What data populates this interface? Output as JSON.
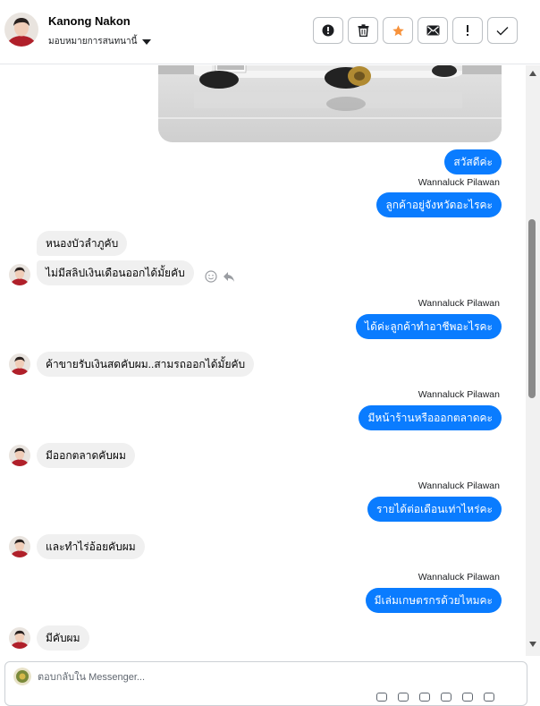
{
  "header": {
    "name": "Kanong Nakon",
    "assign_label": "มอบหมายการสนทนานี้",
    "actions": [
      {
        "name": "alert-circle-icon"
      },
      {
        "name": "trash-icon"
      },
      {
        "name": "star-icon",
        "color": "#f7923b"
      },
      {
        "name": "mail-icon"
      },
      {
        "name": "exclamation-icon"
      },
      {
        "name": "check-icon"
      }
    ]
  },
  "messages": {
    "out1": "สวัสดีค่ะ",
    "sender1": "Wannaluck Pilawan",
    "out2": "ลูกค้าอยู่จังหวัดอะไรคะ",
    "in1": "หนองบัวลำภูคับ",
    "in2": "ไม่มีสลิปเงินเดือนออกได้มั้ยคับ",
    "sender2": "Wannaluck Pilawan",
    "out3": "ได้ค่ะลูกค้าทำอาชีพอะไรคะ",
    "in3": "ค้าขายรับเงินสดคับผม..สามรถออกได้มั้ยคับ",
    "sender3": "Wannaluck Pilawan",
    "out4": "มีหน้าร้านหรือออกตลาดคะ",
    "in4": "มีออกตลาดคับผม",
    "sender4": "Wannaluck Pilawan",
    "out5": "รายได้ต่อเดือนเท่าไหร่คะ",
    "in5": "และทำไร่อ้อยคับผม",
    "sender5": "Wannaluck Pilawan",
    "out6": "มีเล่มเกษตรกรด้วยไหมคะ",
    "in6": "มีคับผม"
  },
  "composer": {
    "placeholder": "ตอบกลับใน Messenger..."
  },
  "colors": {
    "outgoing_bubble": "#0a7cff",
    "incoming_bubble": "#f0f0f0"
  }
}
